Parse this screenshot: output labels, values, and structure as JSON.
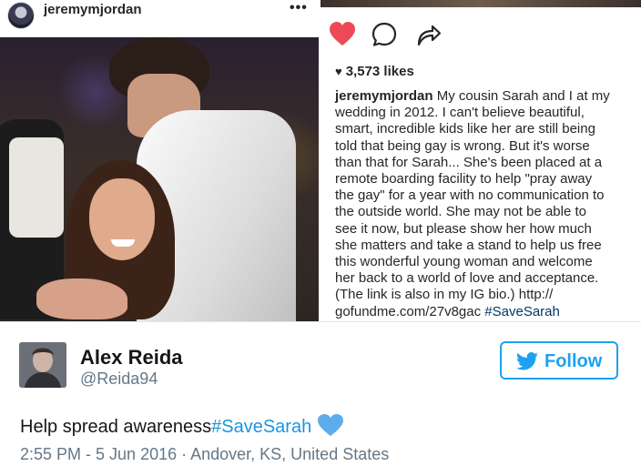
{
  "instagram": {
    "username": "jeremymjordan",
    "more_icon": "ellipsis-icon",
    "more_label": "•••",
    "actions": {
      "like_icon": "heart-filled-icon",
      "comment_icon": "comment-bubble-icon",
      "share_icon": "share-arrow-icon"
    },
    "like_color": "#ed4956",
    "likes": "3,573 likes",
    "caption_user": "jeremymjordan",
    "caption_lines": [
      "My cousin Sarah and I at my",
      "wedding in 2012. I can't believe beautiful,",
      "smart, incredible kids like her are still being",
      "told that being gay is wrong. But it's worse",
      "than that for Sarah... She's been placed at a",
      "remote boarding facility to help \"pray away",
      "the gay\" for a year with no communication to",
      "the outside world. She may not be able to",
      "see it now, but please show her how much",
      "she matters and take a stand to help us free",
      "this wonderful young woman and welcome",
      "her back to a world of love and acceptance.",
      "(The link is also in my IG bio.) http://",
      "gofundme.com/27v8gac"
    ],
    "caption_hashtag": "#SaveSarah"
  },
  "tweet": {
    "name": "Alex Reida",
    "handle": "@Reida94",
    "follow_label": "Follow",
    "follow_icon": "twitter-bird-icon",
    "text": "Help spread awareness",
    "hashtag": "#SaveSarah",
    "emoji_icon": "blue-heart-icon",
    "meta": "2:55 PM - 5 Jun 2016 · Andover, KS, United States",
    "accent_color": "#1da1f2"
  }
}
